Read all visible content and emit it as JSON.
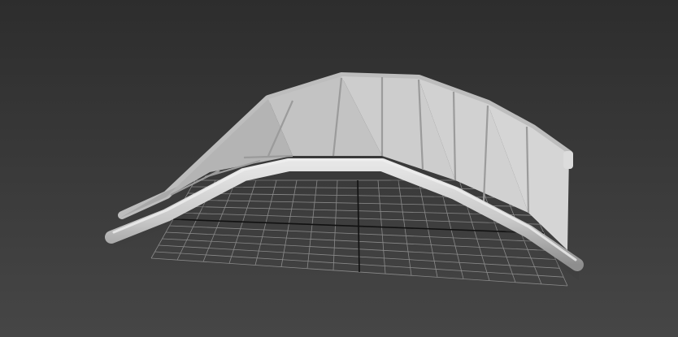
{
  "viewport": {
    "background_top": "#2d2d2d",
    "background_bottom": "#464646",
    "grid_color": "#8a8a8a",
    "axis_color": "#111111",
    "model_light": "#d6d6d6",
    "model_mid": "#bdbdbd",
    "model_dark": "#9b9b9b"
  },
  "grid": {
    "divisions_u": 16,
    "divisions_v": 12
  },
  "model": {
    "name": "arched-bridge-mesh",
    "plank_count": 9
  }
}
